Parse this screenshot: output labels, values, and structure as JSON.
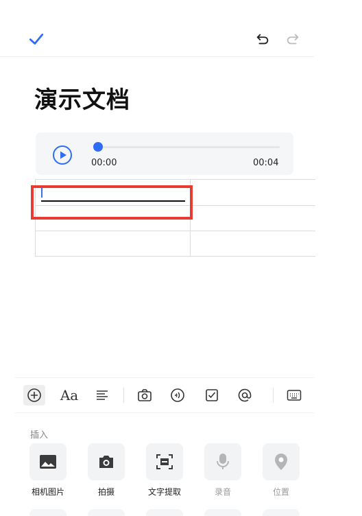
{
  "header": {
    "done_icon": "check-icon",
    "undo_icon": "undo-icon",
    "redo_icon": "redo-icon"
  },
  "document": {
    "title": "演示文档"
  },
  "audio": {
    "play_icon": "play-icon",
    "time_current": "00:00",
    "time_total": "00:04",
    "progress": 0
  },
  "toolbar": {
    "items": [
      "add-icon",
      "font-style-icon",
      "align-icon",
      "camera-icon",
      "audio-icon",
      "checkbox-icon",
      "mention-icon",
      "keyboard-icon"
    ],
    "font_style_label": "Aa"
  },
  "insert_panel": {
    "section_label": "插入",
    "items": [
      {
        "label": "相机图片",
        "icon": "image-icon",
        "enabled": true
      },
      {
        "label": "拍摄",
        "icon": "camera-icon",
        "enabled": true
      },
      {
        "label": "文字提取",
        "icon": "text-scan-icon",
        "enabled": true
      },
      {
        "label": "录音",
        "icon": "microphone-icon",
        "enabled": false
      },
      {
        "label": "位置",
        "icon": "location-icon",
        "enabled": false
      }
    ]
  },
  "colors": {
    "accent": "#2f6df6",
    "highlight_border": "#e63c32",
    "disabled_text": "#9a9a9a"
  }
}
